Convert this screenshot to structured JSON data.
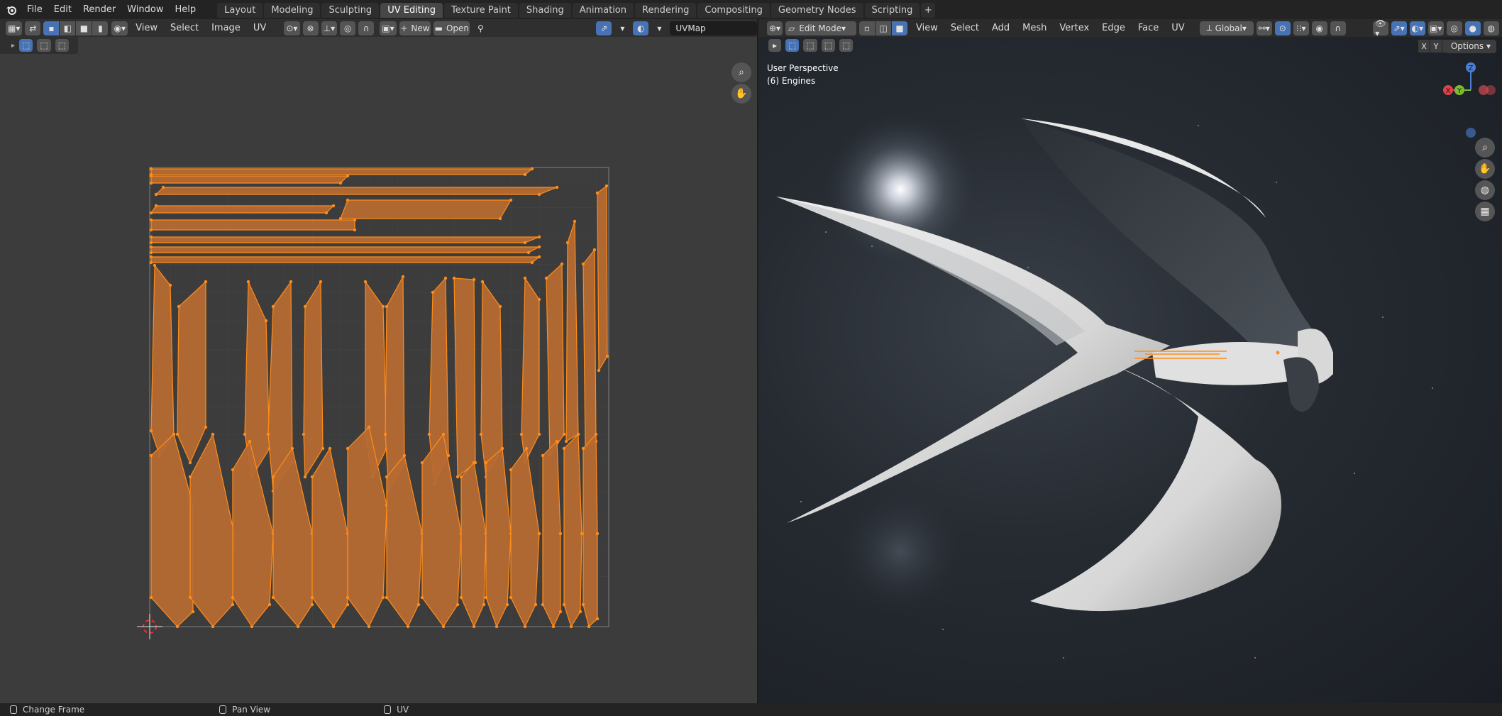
{
  "topbar": {
    "menus": [
      "File",
      "Edit",
      "Render",
      "Window",
      "Help"
    ],
    "workspaces": [
      "Layout",
      "Modeling",
      "Sculpting",
      "UV Editing",
      "Texture Paint",
      "Shading",
      "Animation",
      "Rendering",
      "Compositing",
      "Geometry Nodes",
      "Scripting"
    ],
    "active_workspace": "UV Editing"
  },
  "uv_editor": {
    "menus": [
      "View",
      "Select",
      "Image",
      "UV"
    ],
    "new_label": "New",
    "open_label": "Open",
    "uv_map": "UVMap"
  },
  "viewport": {
    "mode": "Edit Mode",
    "menus": [
      "View",
      "Select",
      "Add",
      "Mesh",
      "Vertex",
      "Edge",
      "Face",
      "UV"
    ],
    "transform_orientation": "Global",
    "info_line1": "User Perspective",
    "info_line2": "(6) Engines",
    "options_label": "Options",
    "axis_x": "X",
    "axis_y": "Y",
    "axis_z": "Z"
  },
  "statusbar": {
    "item1": "Change Frame",
    "item2": "Pan View",
    "item3": "UV"
  },
  "colors": {
    "accent": "#4772b3",
    "uv_fill": "#b66a33",
    "uv_edge": "#ff8c1a",
    "background": "#3c3c3c"
  }
}
